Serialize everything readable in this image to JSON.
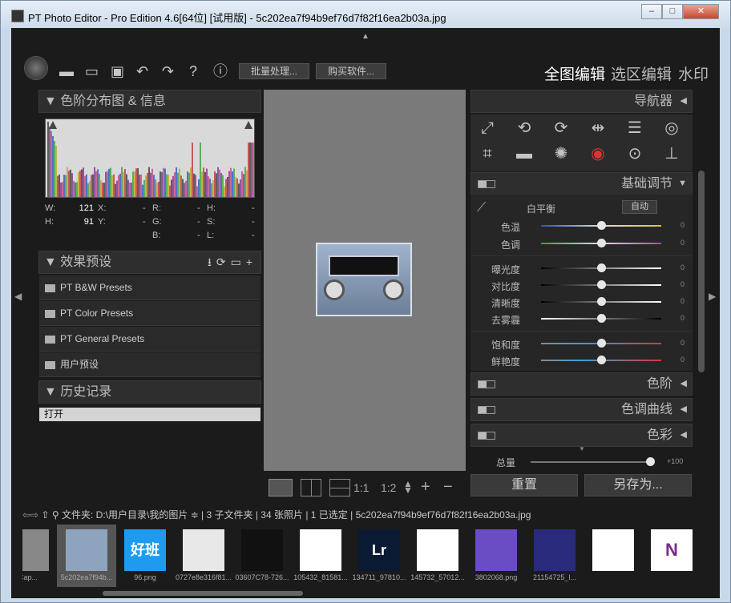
{
  "window": {
    "title": "PT Photo Editor - Pro Edition 4.6[64位] [试用版] - 5c202ea7f94b9ef76d7f82f16ea2b03a.jpg",
    "min": "–",
    "max": "□",
    "close": "✕"
  },
  "toolbar": {
    "batch": "批量处理...",
    "buy": "购买软件...",
    "icons": [
      "folder-icon",
      "save-icon",
      "save-as-icon",
      "undo-icon",
      "redo-icon",
      "help-icon",
      "info-icon"
    ],
    "help_glyph": "?",
    "info_glyph": "ⓘ"
  },
  "modes": [
    "全图编辑",
    "选区编辑",
    "水印"
  ],
  "histogram": {
    "title": "色阶分布图 & 信息",
    "w_label": "W:",
    "w_value": "121",
    "h_label": "H:",
    "h_value": "91",
    "x_label": "X:",
    "x_value": "-",
    "y_label": "Y:",
    "y_value": "-",
    "r_label": "R:",
    "r_value": "-",
    "g_label": "G:",
    "g_value": "-",
    "b_label": "B:",
    "b_value": "-",
    "hh_label": "H:",
    "hh_value": "-",
    "s_label": "S:",
    "s_value": "-",
    "l_label": "L:",
    "l_value": "-"
  },
  "presets": {
    "title": "效果预设",
    "items": [
      "PT B&W Presets",
      "PT Color Presets",
      "PT General Presets",
      "用户预设"
    ]
  },
  "history": {
    "title": "历史记录",
    "items": [
      "打开"
    ]
  },
  "navigator": {
    "title": "导航器"
  },
  "basic": {
    "title": "基础调节",
    "wb_label": "白平衡",
    "auto": "自动",
    "sliders": [
      {
        "label": "色温",
        "value": "0"
      },
      {
        "label": "色调",
        "value": "0"
      },
      {
        "label": "曝光度",
        "value": "0"
      },
      {
        "label": "对比度",
        "value": "0"
      },
      {
        "label": "清晰度",
        "value": "0"
      },
      {
        "label": "去雾霾",
        "value": "0"
      },
      {
        "label": "饱和度",
        "value": "0"
      },
      {
        "label": "鲜艳度",
        "value": "0"
      }
    ]
  },
  "sections": [
    "色阶",
    "色调曲线",
    "色彩"
  ],
  "total": {
    "label": "总量",
    "value": "+100"
  },
  "buttons": {
    "reset": "重置",
    "save_as": "另存为..."
  },
  "viewbar": {
    "one_to_one": "1:1",
    "one_to_two": "1:2",
    "plus": "+",
    "minus": "−"
  },
  "pathbar": {
    "text": "文件夹:  D:\\用户目录\\我的图片 ≑ | 3 子文件夹 | 34 张照片 | 1 已选定 | 5c202ea7f94b9ef76d7f82f16ea2b03a.jpg"
  },
  "filmstrip": [
    {
      "name": "Cap...",
      "color": "#888888"
    },
    {
      "name": "5c202ea7f94b...",
      "color": "#8ea3bd"
    },
    {
      "name": "96.png",
      "color": "#1e9bf0",
      "text": "好班"
    },
    {
      "name": "0727e8e316f81...",
      "color": "#e8e8e8"
    },
    {
      "name": "03607C78-726...",
      "color": "#111111"
    },
    {
      "name": "105432_81581...",
      "color": "#ffffff"
    },
    {
      "name": "134711_97810...",
      "color": "#0a1a33",
      "text": "Lr"
    },
    {
      "name": "145732_57012...",
      "color": "#ffffff"
    },
    {
      "name": "3802068.png",
      "color": "#6a4cc4"
    },
    {
      "name": "21154725_l...",
      "color": "#2a2a7a"
    },
    {
      "name": "",
      "color": "#ffffff"
    },
    {
      "name": "",
      "color": "#ffffff",
      "text": "N"
    }
  ]
}
